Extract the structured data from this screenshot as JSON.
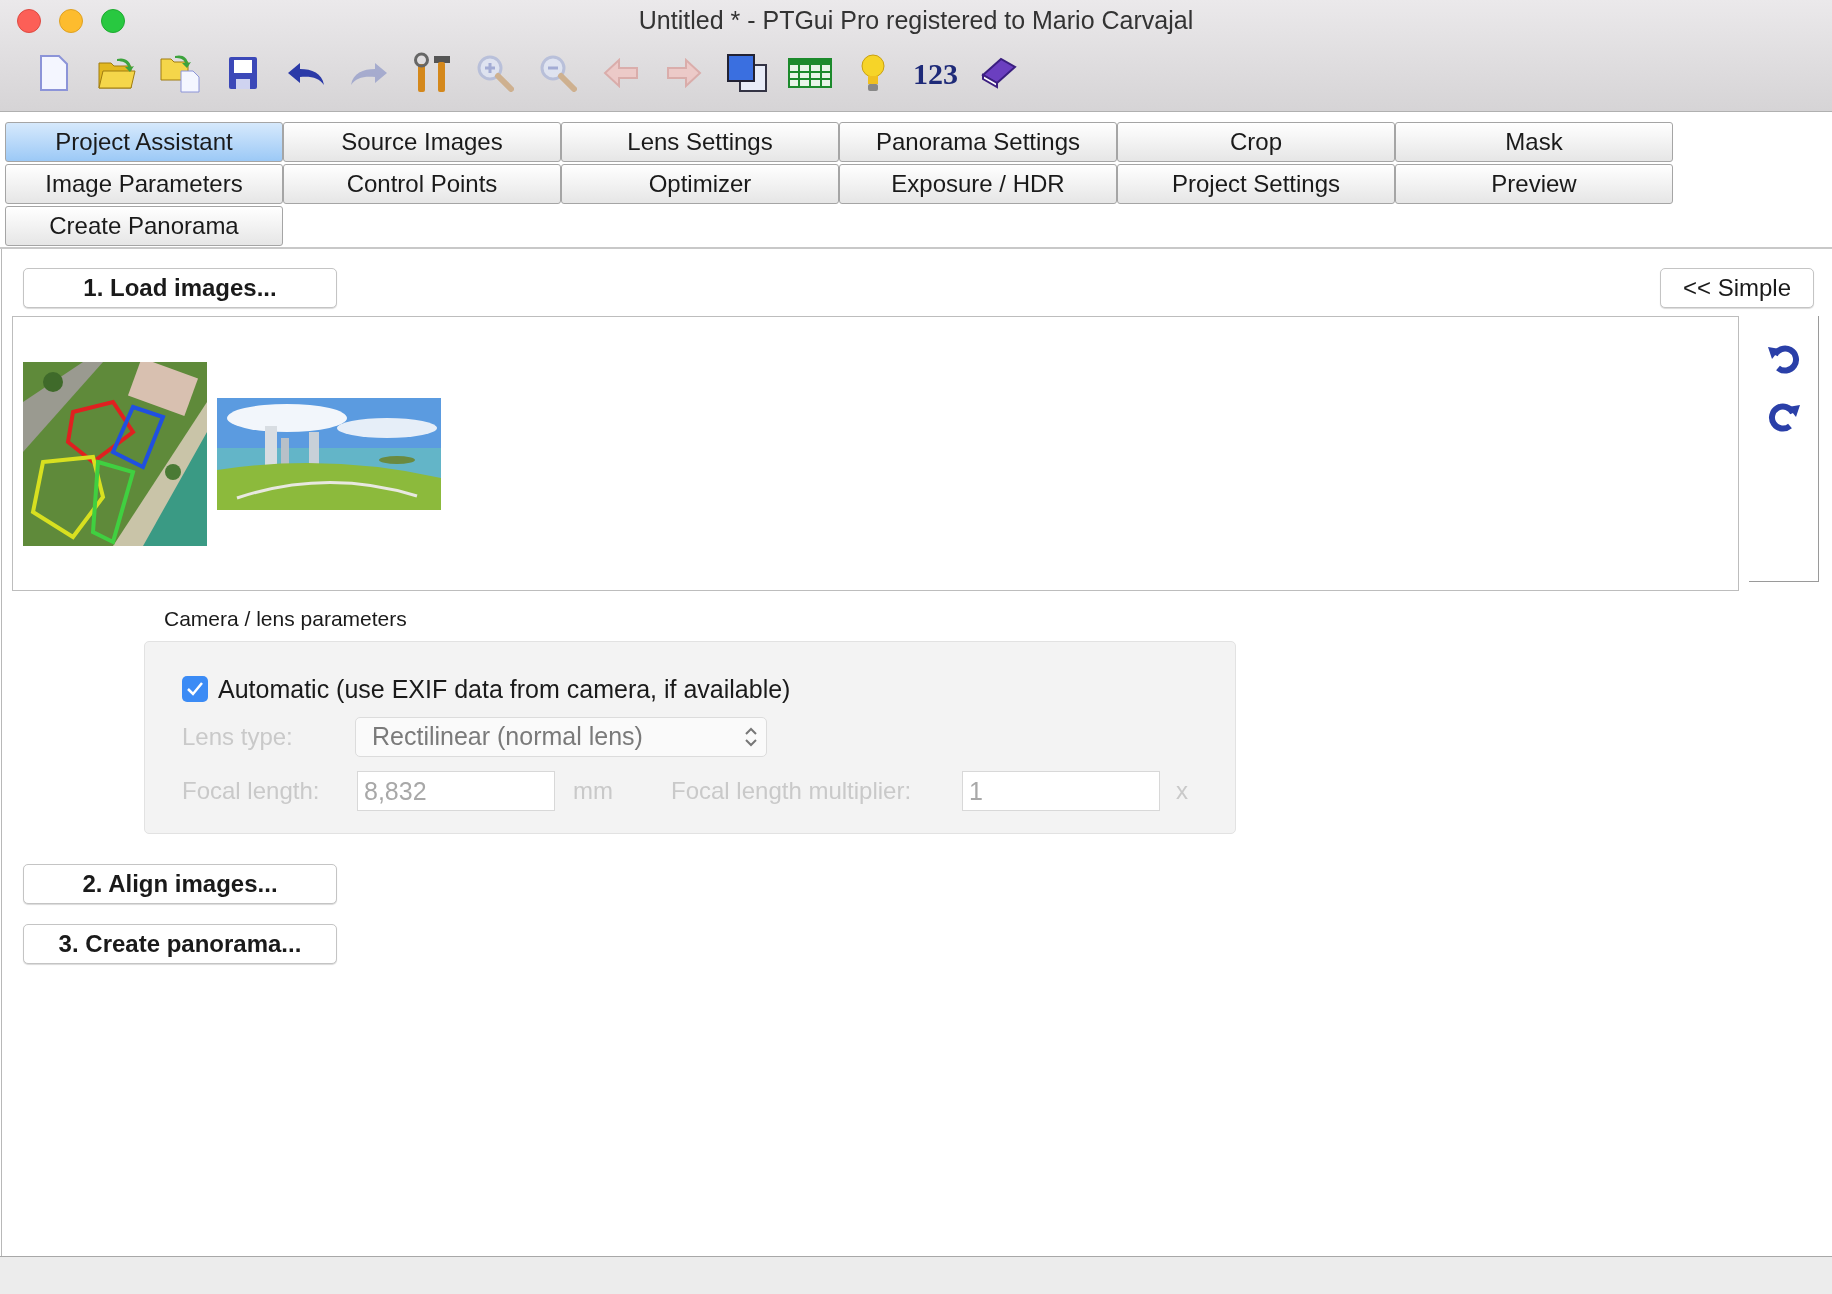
{
  "window": {
    "title": "Untitled * - PTGui Pro registered to Mario Carvajal"
  },
  "toolbar": [
    {
      "kind": "new",
      "disabled": false
    },
    {
      "kind": "open",
      "disabled": false
    },
    {
      "kind": "add",
      "disabled": false
    },
    {
      "kind": "save",
      "disabled": false
    },
    {
      "kind": "undo",
      "disabled": false
    },
    {
      "kind": "redo",
      "disabled": true
    },
    {
      "kind": "tools",
      "disabled": false
    },
    {
      "kind": "zoomin",
      "disabled": true
    },
    {
      "kind": "zoomout",
      "disabled": true
    },
    {
      "kind": "back",
      "disabled": true
    },
    {
      "kind": "forward",
      "disabled": true
    },
    {
      "kind": "windows",
      "disabled": false
    },
    {
      "kind": "table",
      "disabled": false
    },
    {
      "kind": "bulb",
      "disabled": false
    },
    {
      "kind": "text",
      "label": "123",
      "disabled": false
    },
    {
      "kind": "help",
      "disabled": false
    }
  ],
  "tabs": [
    [
      {
        "label": "Project Assistant",
        "selected": true
      },
      {
        "label": "Source Images",
        "selected": false
      },
      {
        "label": "Lens Settings",
        "selected": false
      },
      {
        "label": "Panorama Settings",
        "selected": false
      },
      {
        "label": "Crop",
        "selected": false
      },
      {
        "label": "Mask",
        "selected": false
      }
    ],
    [
      {
        "label": "Image Parameters",
        "selected": false
      },
      {
        "label": "Control Points",
        "selected": false
      },
      {
        "label": "Optimizer",
        "selected": false
      },
      {
        "label": "Exposure / HDR",
        "selected": false
      },
      {
        "label": "Project Settings",
        "selected": false
      },
      {
        "label": "Preview",
        "selected": false
      }
    ],
    [
      {
        "label": "Create Panorama",
        "selected": false
      }
    ]
  ],
  "load_button": "1. Load images...",
  "simple_button": "<< Simple",
  "images": [
    {
      "kind": "aerial"
    },
    {
      "kind": "panorama"
    }
  ],
  "camera": {
    "title": "Camera / lens parameters",
    "automatic": {
      "label": "Automatic (use EXIF data from camera, if available)",
      "checked": true
    },
    "lens_type": {
      "label": "Lens type:",
      "value": "Rectilinear (normal lens)",
      "disabled": true
    },
    "focal_length": {
      "label": "Focal length:",
      "value": "8,832",
      "unit": "mm",
      "disabled": true
    },
    "multiplier": {
      "label": "Focal length multiplier:",
      "value": "1",
      "unit": "x",
      "disabled": true
    }
  },
  "steps": [
    "2. Align images...",
    "3. Create panorama..."
  ]
}
